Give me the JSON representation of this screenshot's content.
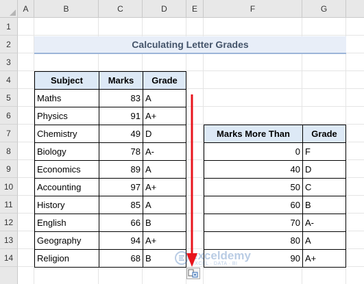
{
  "columns": [
    "A",
    "B",
    "C",
    "D",
    "E",
    "F",
    "G"
  ],
  "rows": [
    "1",
    "2",
    "3",
    "4",
    "5",
    "6",
    "7",
    "8",
    "9",
    "10",
    "11",
    "12",
    "13",
    "14"
  ],
  "title": "Calculating Letter Grades",
  "student_table": {
    "headers": {
      "subject": "Subject",
      "marks": "Marks",
      "grade": "Grade"
    },
    "rows": [
      {
        "subject": "Maths",
        "marks": "83",
        "grade": "A"
      },
      {
        "subject": "Physics",
        "marks": "91",
        "grade": "A+"
      },
      {
        "subject": "Chemistry",
        "marks": "49",
        "grade": "D"
      },
      {
        "subject": "Biology",
        "marks": "78",
        "grade": "A-"
      },
      {
        "subject": "Economics",
        "marks": "89",
        "grade": "A"
      },
      {
        "subject": "Accounting",
        "marks": "97",
        "grade": "A+"
      },
      {
        "subject": "History",
        "marks": "85",
        "grade": "A"
      },
      {
        "subject": "English",
        "marks": "66",
        "grade": "B"
      },
      {
        "subject": "Geography",
        "marks": "94",
        "grade": "A+"
      },
      {
        "subject": "Religion",
        "marks": "68",
        "grade": "B"
      }
    ]
  },
  "lookup_table": {
    "headers": {
      "threshold": "Marks More Than",
      "grade": "Grade"
    },
    "rows": [
      {
        "threshold": "0",
        "grade": "F"
      },
      {
        "threshold": "40",
        "grade": "D"
      },
      {
        "threshold": "50",
        "grade": "C"
      },
      {
        "threshold": "60",
        "grade": "B"
      },
      {
        "threshold": "70",
        "grade": "A-"
      },
      {
        "threshold": "80",
        "grade": "A"
      },
      {
        "threshold": "90",
        "grade": "A+"
      }
    ]
  },
  "watermark": {
    "name": "exceldemy",
    "tagline": "EXCEL · DATA · BI"
  },
  "colors": {
    "table_header_fill": "#dde9f6",
    "title_fill": "#e8eef8",
    "title_text": "#44546a",
    "arrow": "#e8141c"
  },
  "icons": {
    "fill_arrow": "arrow-down-icon",
    "paste_options": "paste-options-icon"
  }
}
